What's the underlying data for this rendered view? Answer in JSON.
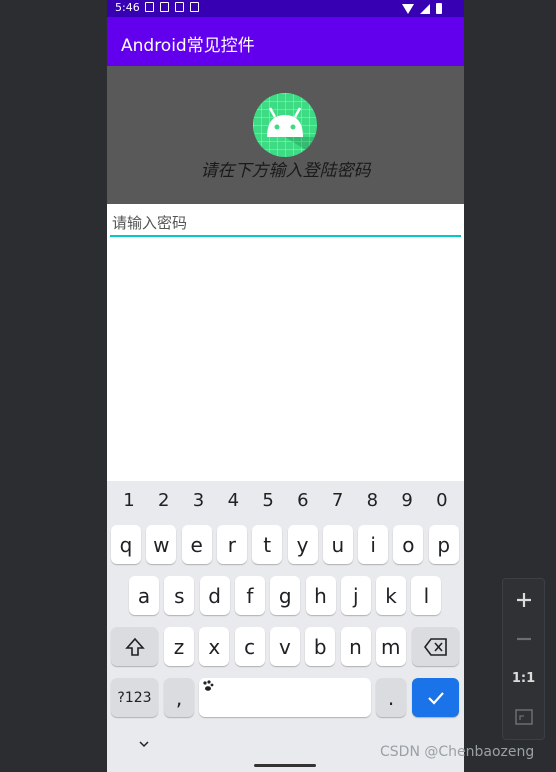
{
  "status_bar": {
    "time": "5:46"
  },
  "app_bar": {
    "title": "Android常见控件"
  },
  "banner": {
    "prompt": "请在下方输入登陆密码",
    "logo_icon": "android-logo-icon"
  },
  "password_field": {
    "placeholder": "请输入密码",
    "value": ""
  },
  "keyboard": {
    "numbers": [
      "1",
      "2",
      "3",
      "4",
      "5",
      "6",
      "7",
      "8",
      "9",
      "0"
    ],
    "row1": [
      "q",
      "w",
      "e",
      "r",
      "t",
      "y",
      "u",
      "i",
      "o",
      "p"
    ],
    "row2": [
      "a",
      "s",
      "d",
      "f",
      "g",
      "h",
      "j",
      "k",
      "l"
    ],
    "row3": [
      "z",
      "x",
      "c",
      "v",
      "b",
      "n",
      "m"
    ],
    "symbols_label": "?123",
    "comma_label": ",",
    "period_label": "."
  },
  "emulator_controls": {
    "ratio_label": "1:1"
  },
  "watermark": "CSDN @Chenbaozeng",
  "colors": {
    "app_bar": "#6200ee",
    "status_bar": "#3700b3",
    "field_underline": "#03c8c8",
    "enter_key": "#1a73e8"
  }
}
